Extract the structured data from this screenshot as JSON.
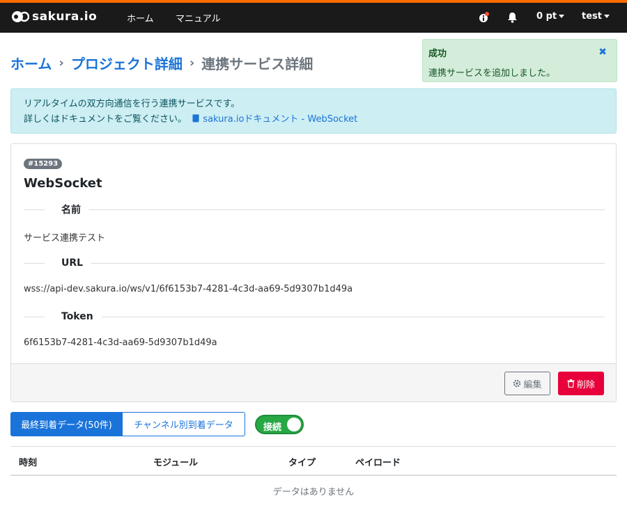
{
  "nav": {
    "logo_text": "sakura.io",
    "links": [
      "ホーム",
      "マニュアル"
    ],
    "points": "0 pt",
    "user": "test"
  },
  "breadcrumb": {
    "home": "ホーム",
    "project": "プロジェクト詳細",
    "current": "連携サービス詳細"
  },
  "toast": {
    "title": "成功",
    "message": "連携サービスを追加しました。",
    "close": "✖"
  },
  "info": {
    "line1": "リアルタイムの双方向通信を行う連携サービスです。",
    "line2": "詳しくはドキュメントをご覧ください。",
    "doc_link": "sakura.ioドキュメント - WebSocket"
  },
  "service": {
    "id_badge": "#15293",
    "type": "WebSocket",
    "name_label": "名前",
    "name": "サービス連携テスト",
    "url_label": "URL",
    "url": "wss://api-dev.sakura.io/ws/v1/6f6153b7-4281-4c3d-aa69-5d9307b1d49a",
    "token_label": "Token",
    "token": "6f6153b7-4281-4c3d-aa69-5d9307b1d49a",
    "edit_label": "編集",
    "delete_label": "削除"
  },
  "tabs": {
    "latest": "最終到着データ(50件)",
    "by_channel": "チャンネル別到着データ"
  },
  "toggle": {
    "label": "接続",
    "on": true
  },
  "table": {
    "headers": [
      "時刻",
      "モジュール",
      "タイプ",
      "ペイロード"
    ],
    "empty_text": "データはありません"
  },
  "colors": {
    "accent": "#1a73d9",
    "danger": "#e8003a",
    "success": "#28a745",
    "topbar": "#ff6a00"
  }
}
